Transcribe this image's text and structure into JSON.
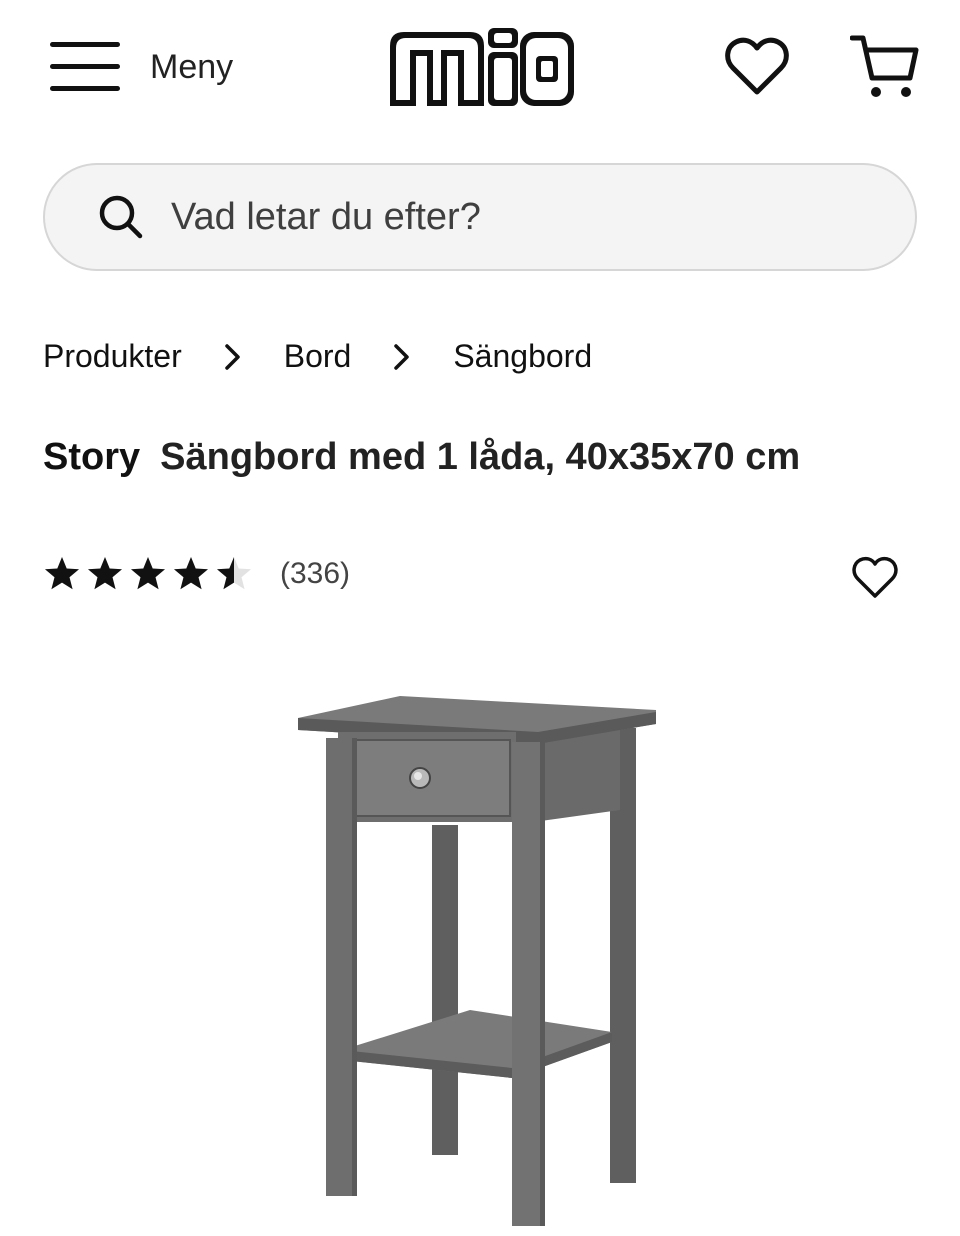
{
  "header": {
    "menu_label": "Meny",
    "logo_text": "mio",
    "favorites_icon": "heart-icon",
    "cart_icon": "cart-icon"
  },
  "search": {
    "placeholder": "Vad letar du efter?",
    "icon": "search-icon"
  },
  "breadcrumb": {
    "items": [
      "Produkter",
      "Bord",
      "Sängbord"
    ]
  },
  "product": {
    "brand": "Story",
    "name": "Sängbord med 1 låda, 40x35x70 cm",
    "rating": 4.5,
    "rating_max": 5,
    "review_count": "(336)",
    "image_alt": "grey-bedside-table"
  },
  "colors": {
    "text": "#1a1a1a",
    "search_bg": "#f4f4f4",
    "search_border": "#d6d6d6",
    "product_grey": "#6e6e6e"
  }
}
